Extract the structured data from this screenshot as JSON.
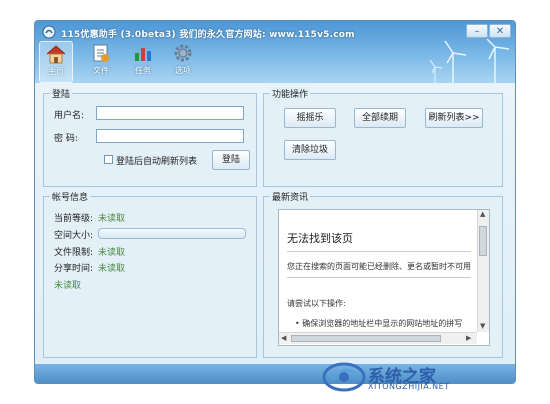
{
  "window": {
    "title": "115优惠助手 (3.0beta3) 我们的永久官方网站: www.115v5.com"
  },
  "toolbar": {
    "items": [
      {
        "label": "主页",
        "icon": "home-icon"
      },
      {
        "label": "文件",
        "icon": "file-icon"
      },
      {
        "label": "任务",
        "icon": "task-icon"
      },
      {
        "label": "选项",
        "icon": "gear-icon"
      }
    ]
  },
  "login": {
    "title": "登陆",
    "username_label": "用户名:",
    "password_label": "密  码:",
    "autologin_label": "登陆后自动刷新列表",
    "login_button": "登陆"
  },
  "functions": {
    "title": "功能操作",
    "buttons": [
      "摇摇乐",
      "全部续期",
      "刷新列表>>",
      "清除垃圾"
    ]
  },
  "account": {
    "title": "帐号信息",
    "level_label": "当前等级:",
    "level_value": "未读取",
    "space_label": "空间大小:",
    "filelimit_label": "文件限制:",
    "filelimit_value": "未读取",
    "sharetime_label": "分享时间:",
    "sharetime_value": "未读取",
    "extra_value": "未读取"
  },
  "news": {
    "title": "最新资讯",
    "heading": "无法找到该页",
    "message": "您正在搜索的页面可能已经删除、更名或暂时不可用",
    "suggest": "请尝试以下操作:",
    "bullet": "确保浏览器的地址栏中显示的网站地址的拼写"
  },
  "watermark": {
    "title": "系统之家",
    "url": "XITONGZHIJIA.NET"
  },
  "colors": {
    "accent": "#4d97d6",
    "value_green": "#4e8a3f"
  }
}
